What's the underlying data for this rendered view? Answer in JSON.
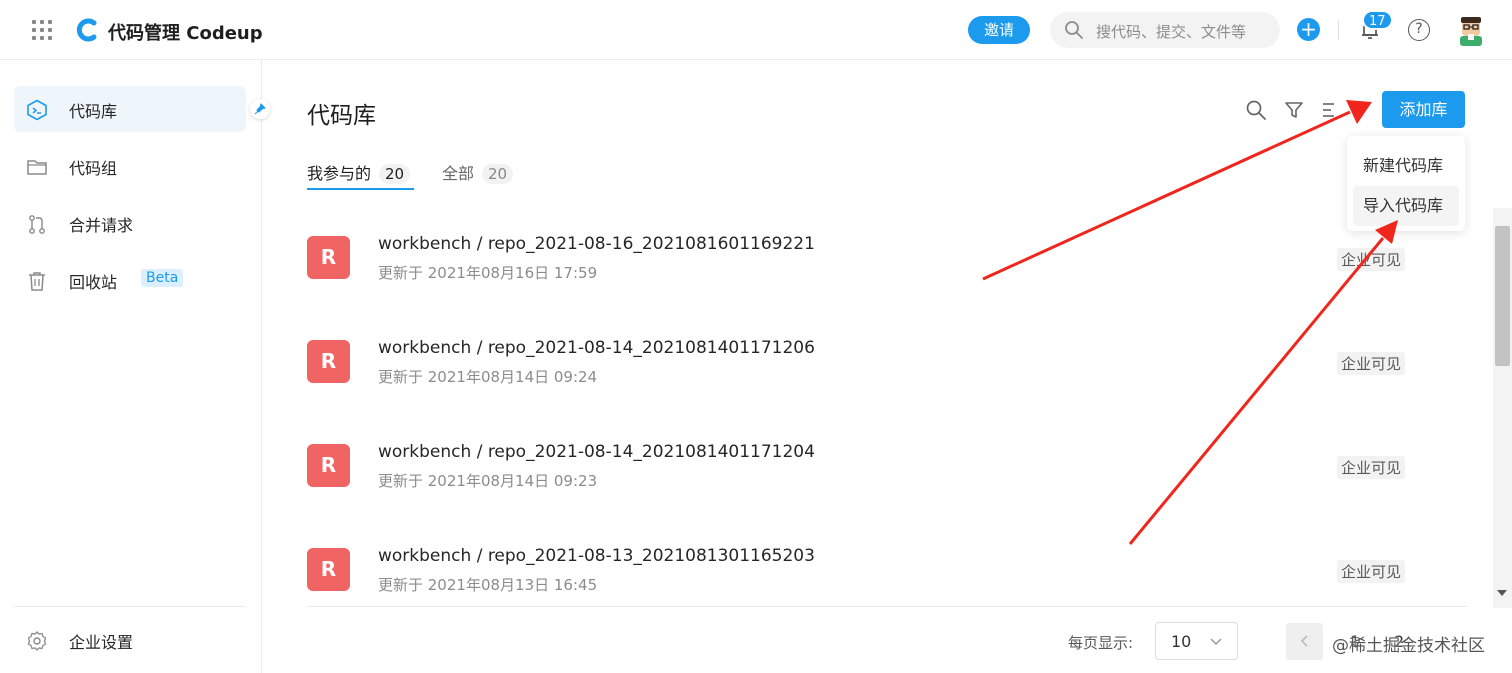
{
  "header": {
    "brand": "代码管理 Codeup",
    "invite_label": "邀请",
    "search_placeholder": "搜代码、提交、文件等",
    "notification_count": "17"
  },
  "sidebar": {
    "items": [
      {
        "label": "代码库",
        "icon": "repo-icon",
        "active": true
      },
      {
        "label": "代码组",
        "icon": "folder-icon"
      },
      {
        "label": "合并请求",
        "icon": "merge-request-icon"
      },
      {
        "label": "回收站",
        "icon": "trash-icon",
        "badge": "Beta"
      }
    ],
    "settings_label": "企业设置"
  },
  "main": {
    "title": "代码库",
    "add_button": "添加库",
    "tabs": [
      {
        "label": "我参与的",
        "count": "20",
        "active": true
      },
      {
        "label": "全部",
        "count": "20"
      }
    ],
    "dropdown": [
      "新建代码库",
      "导入代码库"
    ],
    "repos": [
      {
        "initial": "R",
        "name": "workbench / repo_2021-08-16_2021081601169221",
        "updated": "更新于 2021年08月16日 17:59",
        "visibility": "企业可见"
      },
      {
        "initial": "R",
        "name": "workbench / repo_2021-08-14_2021081401171206",
        "updated": "更新于 2021年08月14日 09:24",
        "visibility": "企业可见"
      },
      {
        "initial": "R",
        "name": "workbench / repo_2021-08-14_2021081401171204",
        "updated": "更新于 2021年08月14日 09:23",
        "visibility": "企业可见"
      },
      {
        "initial": "R",
        "name": "workbench / repo_2021-08-13_2021081301165203",
        "updated": "更新于 2021年08月13日 16:45",
        "visibility": "企业可见"
      }
    ]
  },
  "footer": {
    "per_page_label": "每页显示:",
    "page_size": "10",
    "pages": [
      "1",
      "2"
    ],
    "watermark": "@稀土掘金技术社区"
  },
  "colors": {
    "accent": "#1b9aee",
    "repo_icon": "#f06464",
    "annotation_arrow": "#f0261d"
  }
}
